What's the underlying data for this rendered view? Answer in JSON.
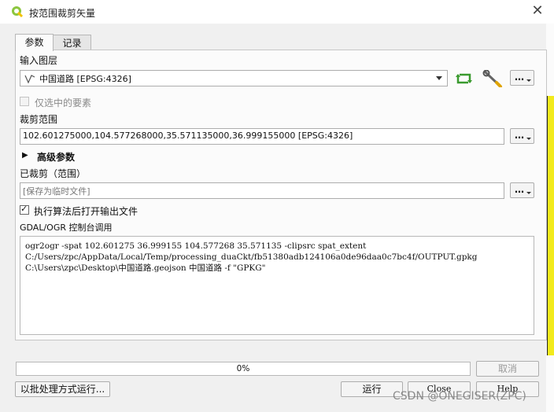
{
  "window": {
    "title": "按范围裁剪矢量",
    "close_symbol": "✕"
  },
  "tabs": [
    {
      "label": "参数"
    },
    {
      "label": "记录"
    }
  ],
  "input_layer": {
    "label": "输入图层",
    "value": "中国道路 [EPSG:4326]",
    "dots": "…"
  },
  "selected_only": {
    "label": "仅选中的要素",
    "checked": false
  },
  "clip_extent": {
    "label": "裁剪范围",
    "value": "102.601275000,104.577268000,35.571135000,36.999155000 [EPSG:4326]",
    "dots": "…"
  },
  "advanced": {
    "label": "高级参数",
    "expander": "▶"
  },
  "output": {
    "label": "已裁剪（范围）",
    "placeholder": "[保存为临时文件]",
    "dots": "…"
  },
  "open_after": {
    "label": "执行算法后打开输出文件",
    "checked": true,
    "check_mark": "✓"
  },
  "console": {
    "label": "GDAL/OGR 控制台调用",
    "text": "ogr2ogr -spat 102.601275 36.999155 104.577268 35.571135 -clipsrc spat_extent C:/Users/zpc/AppData/Local/Temp/processing_duaCkt/fb51380adb124106a0de96daa0c7bc4f/OUTPUT.gpkg C:\\Users\\zpc\\Desktop\\中国道路.geojson 中国道路 -f \"GPKG\""
  },
  "progress": {
    "percent": 0,
    "text": "0%"
  },
  "buttons": {
    "cancel": "取消",
    "batch": "以批处理方式运行...",
    "run": "运行",
    "close": "Close",
    "help": "Help"
  },
  "watermark": "CSDN @ONEGISER(ZPC)",
  "colors": {
    "accent_green": "#3a9a2e",
    "map_yellow": "#f2ea1c"
  },
  "icons": [
    "qgis-logo-icon",
    "line-layer-icon",
    "refresh-icon",
    "wrench-icon",
    "close-icon",
    "dropdown-arrow-icon",
    "expander-icon",
    "checkbox-icon"
  ]
}
